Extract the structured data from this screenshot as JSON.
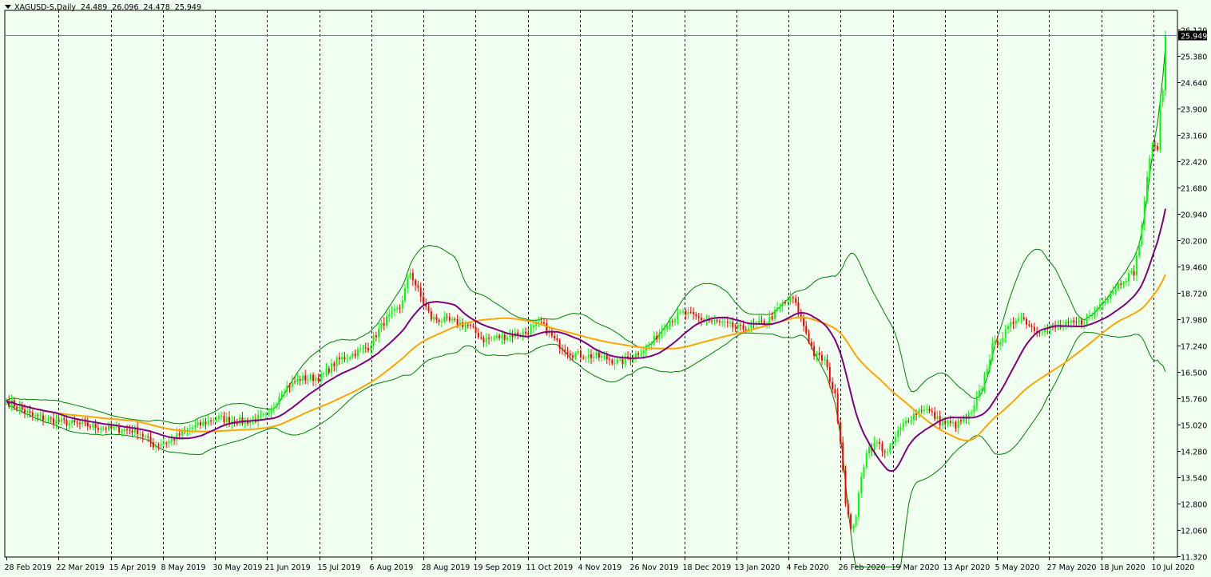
{
  "window": {
    "symbol_timeframe": "XAGUSD-S,Daily",
    "ohlc": [
      "24.489",
      "26.096",
      "24.478",
      "25.949"
    ],
    "current_price_label": "25.949"
  },
  "colors": {
    "background": "#f0fff0",
    "bull_candle": "#00ff00",
    "bear_candle": "#ff0000",
    "bollinger": "#008000",
    "ma_fast": "#800080",
    "ma_slow": "#ffa500",
    "grid": "#000000"
  },
  "chart_data": {
    "type": "candlestick",
    "ylim": [
      11.32,
      26.12
    ],
    "y_ticks": [
      "26.120",
      "25.380",
      "24.640",
      "23.900",
      "23.160",
      "22.420",
      "21.680",
      "20.940",
      "20.200",
      "19.460",
      "18.720",
      "17.980",
      "17.240",
      "16.500",
      "15.760",
      "15.020",
      "14.280",
      "13.540",
      "12.800",
      "12.060",
      "11.320"
    ],
    "x_ticks": [
      "28 Feb 2019",
      "22 Mar 2019",
      "15 Apr 2019",
      "8 May 2019",
      "30 May 2019",
      "21 Jun 2019",
      "15 Jul 2019",
      "6 Aug 2019",
      "28 Aug 2019",
      "19 Sep 2019",
      "11 Oct 2019",
      "4 Nov 2019",
      "26 Nov 2019",
      "18 Dec 2019",
      "13 Jan 2020",
      "4 Feb 2020",
      "26 Feb 2020",
      "19 Mar 2020",
      "13 Apr 2020",
      "5 May 2020",
      "27 May 2020",
      "18 Jun 2020",
      "10 Jul 2020"
    ],
    "close_anchors": [
      [
        0,
        15.7
      ],
      [
        10,
        15.25
      ],
      [
        20,
        15.1
      ],
      [
        30,
        15.0
      ],
      [
        40,
        14.9
      ],
      [
        50,
        14.85
      ],
      [
        56,
        14.45
      ],
      [
        62,
        14.55
      ],
      [
        70,
        14.9
      ],
      [
        80,
        15.2
      ],
      [
        90,
        15.1
      ],
      [
        100,
        15.25
      ],
      [
        105,
        16.0
      ],
      [
        112,
        16.3
      ],
      [
        120,
        16.35
      ],
      [
        126,
        16.8
      ],
      [
        132,
        17.0
      ],
      [
        138,
        17.2
      ],
      [
        144,
        17.9
      ],
      [
        150,
        18.3
      ],
      [
        154,
        19.3
      ],
      [
        158,
        18.6
      ],
      [
        162,
        18.0
      ],
      [
        170,
        17.9
      ],
      [
        176,
        17.8
      ],
      [
        182,
        17.4
      ],
      [
        190,
        17.5
      ],
      [
        198,
        17.6
      ],
      [
        204,
        17.85
      ],
      [
        210,
        17.3
      ],
      [
        216,
        17.0
      ],
      [
        222,
        16.95
      ],
      [
        228,
        16.9
      ],
      [
        234,
        16.75
      ],
      [
        240,
        17.0
      ],
      [
        246,
        17.3
      ],
      [
        252,
        17.9
      ],
      [
        258,
        18.15
      ],
      [
        264,
        18.0
      ],
      [
        270,
        17.9
      ],
      [
        280,
        17.7
      ],
      [
        290,
        17.9
      ],
      [
        296,
        18.4
      ],
      [
        300,
        18.55
      ],
      [
        304,
        17.8
      ],
      [
        308,
        17.0
      ],
      [
        312,
        16.8
      ],
      [
        316,
        15.8
      ],
      [
        318,
        14.6
      ],
      [
        320,
        12.9
      ],
      [
        322,
        12.0
      ],
      [
        324,
        12.5
      ],
      [
        326,
        13.5
      ],
      [
        328,
        14.3
      ],
      [
        332,
        14.5
      ],
      [
        336,
        14.2
      ],
      [
        340,
        14.8
      ],
      [
        344,
        15.2
      ],
      [
        350,
        15.5
      ],
      [
        356,
        15.1
      ],
      [
        362,
        15.0
      ],
      [
        368,
        15.3
      ],
      [
        372,
        16.1
      ],
      [
        376,
        17.2
      ],
      [
        380,
        17.5
      ],
      [
        386,
        18.1
      ],
      [
        392,
        17.7
      ],
      [
        398,
        17.7
      ],
      [
        404,
        17.8
      ],
      [
        410,
        17.9
      ],
      [
        414,
        18.1
      ],
      [
        418,
        18.5
      ],
      [
        422,
        18.8
      ],
      [
        426,
        19.1
      ],
      [
        430,
        19.3
      ],
      [
        432,
        20.1
      ],
      [
        434,
        21.2
      ],
      [
        436,
        22.6
      ],
      [
        438,
        22.9
      ],
      [
        439,
        22.7
      ],
      [
        440,
        24.1
      ],
      [
        441,
        24.5
      ],
      [
        442,
        25.949
      ]
    ],
    "series": [
      {
        "name": "XAGUSD-S,Daily",
        "type": "candles"
      },
      {
        "type": "moving_average",
        "color": "#800080"
      },
      {
        "type": "moving_average",
        "color": "#ffa500"
      },
      {
        "type": "bollinger_bands",
        "color": "#008000"
      }
    ],
    "grid": "vertical-dashed",
    "current_price": 25.949
  }
}
